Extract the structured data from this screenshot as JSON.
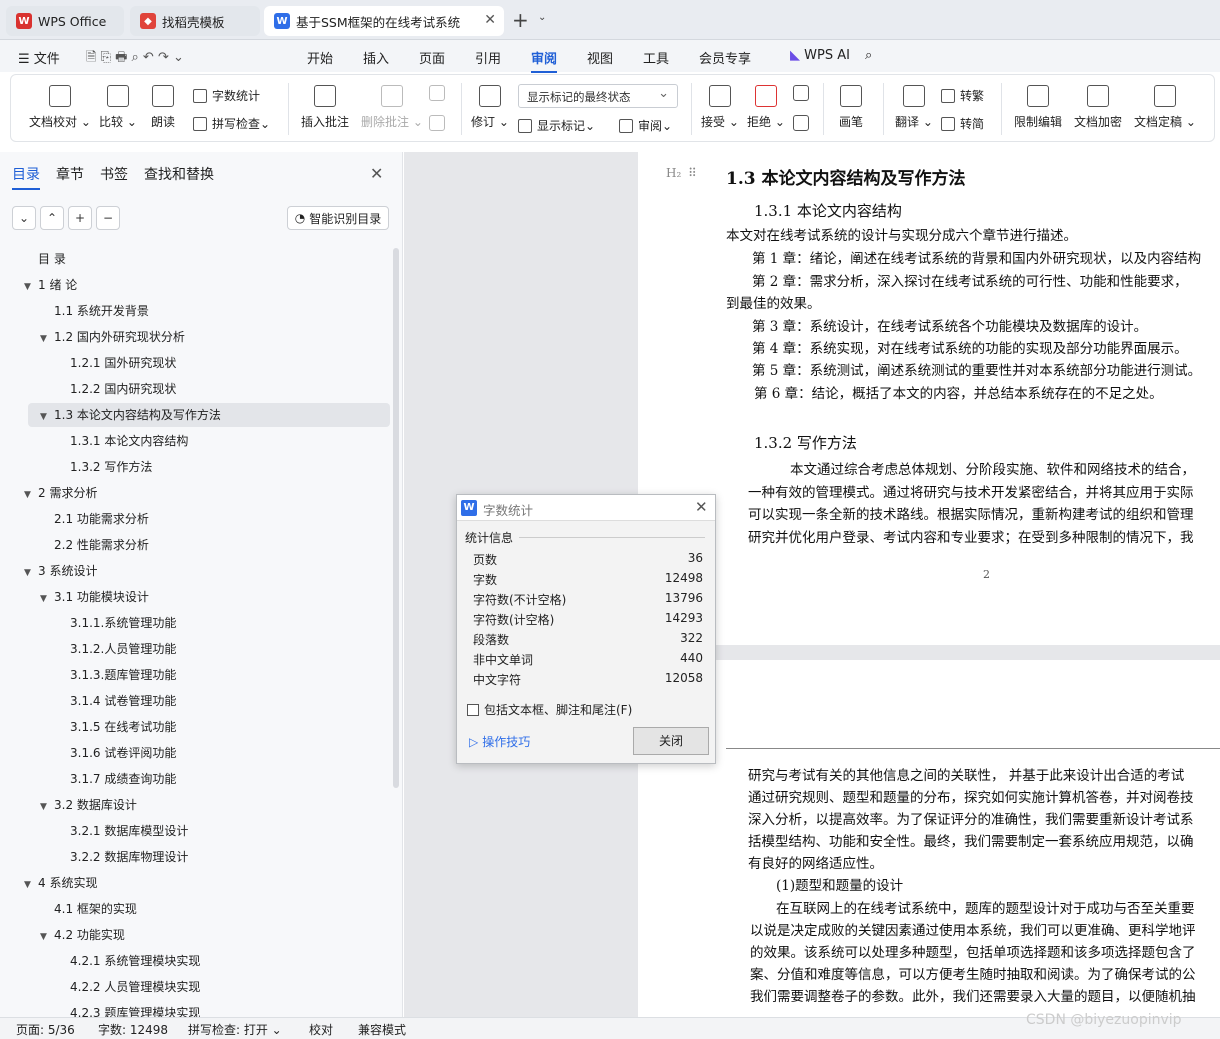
{
  "tabs": [
    {
      "label": "WPS Office",
      "icon": "wps-logo-icon",
      "color": "#d9322f"
    },
    {
      "label": "找稻壳模板",
      "icon": "docer-icon",
      "color": "#e0443b"
    },
    {
      "label": "基于SSM框架的在线考试系统",
      "icon": "writer-w-icon",
      "color": "#2f6ee8"
    }
  ],
  "menu": {
    "file": "文件",
    "items": [
      "开始",
      "插入",
      "页面",
      "引用",
      "审阅",
      "视图",
      "工具",
      "会员专享"
    ],
    "active": "审阅",
    "ai": "WPS AI"
  },
  "ribbon": {
    "doc_check": "文档校对",
    "compare": "比较",
    "read_aloud": "朗读",
    "word_count": "字数统计",
    "spell_check": "拼写检查",
    "insert_comment": "插入批注",
    "delete_comment": "删除批注",
    "track": "修订",
    "markup_state": "显示标记的最终状态",
    "show_markup": "显示标记",
    "review": "审阅",
    "accept": "接受",
    "reject": "拒绝",
    "pen": "画笔",
    "translate": "翻译",
    "to_trad": "转繁",
    "to_simp": "转简",
    "restrict": "限制编辑",
    "encrypt": "文档加密",
    "finalize": "文档定稿"
  },
  "sidebar": {
    "tabs": [
      "目录",
      "章节",
      "书签",
      "查找和替换"
    ],
    "smart_toc": "智能识别目录",
    "toc": [
      {
        "label": "目 录",
        "level": 0,
        "tri": false
      },
      {
        "label": "1 绪 论",
        "level": 0,
        "tri": true
      },
      {
        "label": "1.1 系统开发背景",
        "level": 1,
        "tri": false
      },
      {
        "label": "1.2 国内外研究现状分析",
        "level": 1,
        "tri": true
      },
      {
        "label": "1.2.1 国外研究现状",
        "level": 2,
        "tri": false
      },
      {
        "label": "1.2.2 国内研究现状",
        "level": 2,
        "tri": false
      },
      {
        "label": "1.3 本论文内容结构及写作方法",
        "level": 1,
        "tri": true
      },
      {
        "label": "1.3.1 本论文内容结构",
        "level": 2,
        "tri": false
      },
      {
        "label": "1.3.2 写作方法",
        "level": 2,
        "tri": false
      },
      {
        "label": "2 需求分析",
        "level": 0,
        "tri": true
      },
      {
        "label": "2.1 功能需求分析",
        "level": 1,
        "tri": false
      },
      {
        "label": "2.2 性能需求分析",
        "level": 1,
        "tri": false
      },
      {
        "label": "3 系统设计",
        "level": 0,
        "tri": true
      },
      {
        "label": "3.1 功能模块设计",
        "level": 1,
        "tri": true
      },
      {
        "label": "3.1.1.系统管理功能",
        "level": 2,
        "tri": false
      },
      {
        "label": "3.1.2.人员管理功能",
        "level": 2,
        "tri": false
      },
      {
        "label": "3.1.3.题库管理功能",
        "level": 2,
        "tri": false
      },
      {
        "label": "3.1.4 试卷管理功能",
        "level": 2,
        "tri": false
      },
      {
        "label": "3.1.5 在线考试功能",
        "level": 2,
        "tri": false
      },
      {
        "label": "3.1.6 试卷评阅功能",
        "level": 2,
        "tri": false
      },
      {
        "label": "3.1.7 成绩查询功能",
        "level": 2,
        "tri": false
      },
      {
        "label": "3.2 数据库设计",
        "level": 1,
        "tri": true
      },
      {
        "label": "3.2.1 数据库模型设计",
        "level": 2,
        "tri": false
      },
      {
        "label": "3.2.2 数据库物理设计",
        "level": 2,
        "tri": false
      },
      {
        "label": "4 系统实现",
        "level": 0,
        "tri": true
      },
      {
        "label": "4.1 框架的实现",
        "level": 1,
        "tri": false
      },
      {
        "label": "4.2 功能实现",
        "level": 1,
        "tri": true
      },
      {
        "label": "4.2.1 系统管理模块实现",
        "level": 2,
        "tri": false
      },
      {
        "label": "4.2.2 人员管理模块实现",
        "level": 2,
        "tri": false
      },
      {
        "label": "4.2.3 题库管理模块实现",
        "level": 2,
        "tri": false
      }
    ]
  },
  "doc": {
    "heading_marker": "H₂",
    "h1": "1.3 本论文内容结构及写作方法",
    "h2a": "1.3.1 本论文内容结构",
    "p1": "本文对在线考试系统的设计与实现分成六个章节进行描述。",
    "c1": "第 1 章：绪论，阐述在线考试系统的背景和国内外研究现状，以及内容结构",
    "c2": "第 2 章：需求分析，深入探讨在线考试系统的可行性、功能和性能要求，",
    "c2b": "到最佳的效果。",
    "c3": "第 3 章：系统设计，在线考试系统各个功能模块及数据库的设计。",
    "c4": "第 4 章：系统实现，对在线考试系统的功能的实现及部分功能界面展示。",
    "c5": "第 5 章：系统测试，阐述系统测试的重要性并对本系统部分功能进行测试。",
    "c6": "第 6 章：结论，概括了本文的内容，并总结本系统存在的不足之处。",
    "h2b": "1.3.2 写作方法",
    "w1": "本文通过综合考虑总体规划、分阶段实施、软件和网络技术的结合，",
    "w2": "一种有效的管理模式。通过将研究与技术开发紧密结合，并将其应用于实际",
    "w3": "可以实现一条全新的技术路线。根据实际情况，重新构建考试的组织和管理",
    "w4": "研究并优化用户登录、考试内容和专业要求；在受到多种限制的情况下，我",
    "page_num": "2",
    "n1": "研究与考试有关的其他信息之间的关联性， 并基于此来设计出合适的考试",
    "n2": "通过研究规则、题型和题量的分布，探究如何实施计算机答卷，并对阅卷技",
    "n3": "深入分析，以提高效率。为了保证评分的准确性，我们需要重新设计考试系",
    "n4": "括模型结构、功能和安全性。最终，我们需要制定一套系统应用规范，以确",
    "n5": "有良好的网络适应性。",
    "n6": "(1)题型和题量的设计",
    "n7": "在互联网上的在线考试系统中，题库的题型设计对于成功与否至关重要",
    "n8": "以说是决定成败的关键因素通过使用本系统，我们可以更准确、更科学地评",
    "n9": "的效果。该系统可以处理多种题型，包括单项选择题和该多项选择题包含了",
    "n10": "案、分值和难度等信息，可以方便考生随时抽取和阅读。为了确保考试的公",
    "n11": "我们需要调整卷子的参数。此外，我们还需要录入大量的题目，以便随机抽"
  },
  "dialog": {
    "title": "字数统计",
    "section": "统计信息",
    "rows": [
      {
        "k": "页数",
        "v": "36"
      },
      {
        "k": "字数",
        "v": "12498"
      },
      {
        "k": "字符数(不计空格)",
        "v": "13796"
      },
      {
        "k": "字符数(计空格)",
        "v": "14293"
      },
      {
        "k": "段落数",
        "v": "322"
      },
      {
        "k": "非中文单词",
        "v": "440"
      },
      {
        "k": "中文字符",
        "v": "12058"
      }
    ],
    "checkbox": "包括文本框、脚注和尾注(F)",
    "tips": "操作技巧",
    "close": "关闭"
  },
  "status": {
    "page": "页面: 5/36",
    "words": "字数: 12498",
    "spell": "拼写检查: 打开",
    "proof": "校对",
    "compat": "兼容模式"
  },
  "watermark": "CSDN @biyezuopinvip"
}
